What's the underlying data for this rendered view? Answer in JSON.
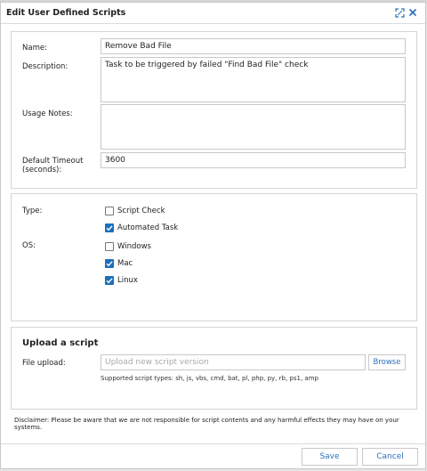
{
  "dialog": {
    "title": "Edit User Defined Scripts"
  },
  "general": {
    "name_label": "Name:",
    "name_value": "Remove Bad File",
    "description_label": "Description:",
    "description_value": "Task to be triggered by failed \"Find Bad File\" check",
    "usage_label": "Usage Notes:",
    "usage_value": "",
    "timeout_label": "Default Timeout (seconds):",
    "timeout_value": "3600"
  },
  "type": {
    "label": "Type:",
    "options": [
      {
        "label": "Script Check",
        "checked": false
      },
      {
        "label": "Automated Task",
        "checked": true
      }
    ]
  },
  "os": {
    "label": "OS:",
    "options": [
      {
        "label": "Windows",
        "checked": false
      },
      {
        "label": "Mac",
        "checked": true
      },
      {
        "label": "Linux",
        "checked": true
      }
    ]
  },
  "upload": {
    "title": "Upload a script",
    "file_label": "File upload:",
    "placeholder": "Upload new script version",
    "browse_label": "Browse",
    "supported": "Supported script types: sh, js, vbs, cmd, bat, pl, php, py, rb, ps1, amp"
  },
  "disclaimer": "Disclaimer: Please be aware that we are not responsible for script contents and any harmful effects they may have on your systems.",
  "footer": {
    "save_label": "Save",
    "cancel_label": "Cancel"
  },
  "colors": {
    "accent": "#1e6fb8",
    "link": "#2c6fb8"
  }
}
